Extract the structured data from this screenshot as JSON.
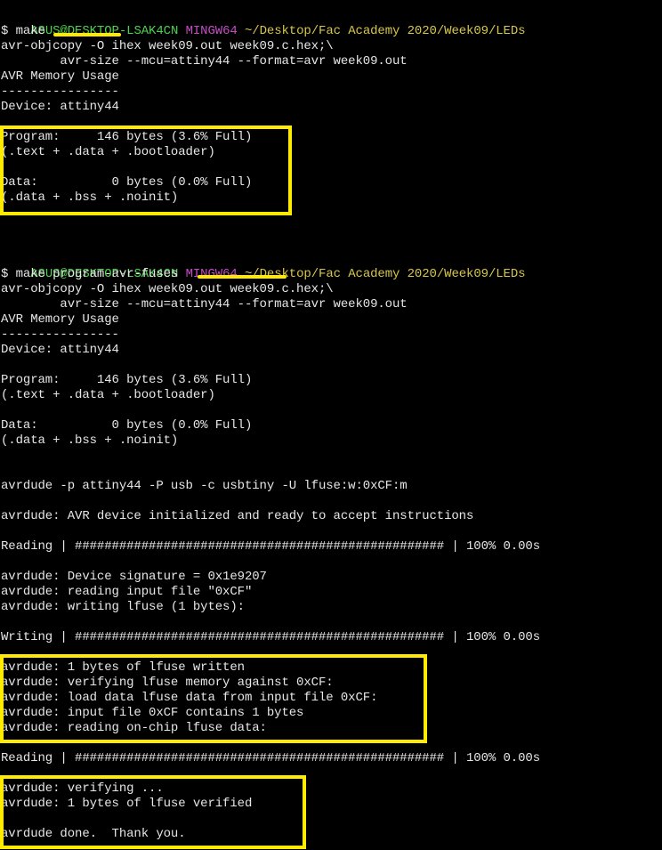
{
  "prompt": {
    "user_host": "ASUS@DESKTOP-LSAK4CN",
    "shell": "MINGW64",
    "path": "~/Desktop/Fac Academy 2020/Week09/LEDs"
  },
  "colors": {
    "highlight": "#ffea00",
    "prompt_green": "#4cd34c",
    "prompt_magenta": "#c64cc6",
    "prompt_yellow": "#d6c64c"
  },
  "block1": {
    "cmd": "$ make",
    "out": [
      "avr-objcopy -O ihex week09.out week09.c.hex;\\",
      "        avr-size --mcu=attiny44 --format=avr week09.out",
      "AVR Memory Usage",
      "----------------",
      "Device: attiny44",
      "",
      "Program:     146 bytes (3.6% Full)",
      "(.text + .data + .bootloader)",
      "",
      "Data:          0 bytes (0.0% Full)",
      "(.data + .bss + .noinit)"
    ]
  },
  "block2": {
    "cmd": "$ make program-avr-fuses",
    "out": [
      "avr-objcopy -O ihex week09.out week09.c.hex;\\",
      "        avr-size --mcu=attiny44 --format=avr week09.out",
      "AVR Memory Usage",
      "----------------",
      "Device: attiny44",
      "",
      "Program:     146 bytes (3.6% Full)",
      "(.text + .data + .bootloader)",
      "",
      "Data:          0 bytes (0.0% Full)",
      "(.data + .bss + .noinit)",
      "",
      "",
      "avrdude -p attiny44 -P usb -c usbtiny -U lfuse:w:0xCF:m",
      "",
      "avrdude: AVR device initialized and ready to accept instructions",
      "",
      "Reading | ################################################## | 100% 0.00s",
      "",
      "avrdude: Device signature = 0x1e9207",
      "avrdude: reading input file \"0xCF\"",
      "avrdude: writing lfuse (1 bytes):",
      "",
      "Writing | ################################################## | 100% 0.00s",
      "",
      "avrdude: 1 bytes of lfuse written",
      "avrdude: verifying lfuse memory against 0xCF:",
      "avrdude: load data lfuse data from input file 0xCF:",
      "avrdude: input file 0xCF contains 1 bytes",
      "avrdude: reading on-chip lfuse data:",
      "",
      "Reading | ################################################## | 100% 0.00s",
      "",
      "avrdude: verifying ...",
      "avrdude: 1 bytes of lfuse verified",
      "",
      "avrdude done.  Thank you."
    ]
  }
}
